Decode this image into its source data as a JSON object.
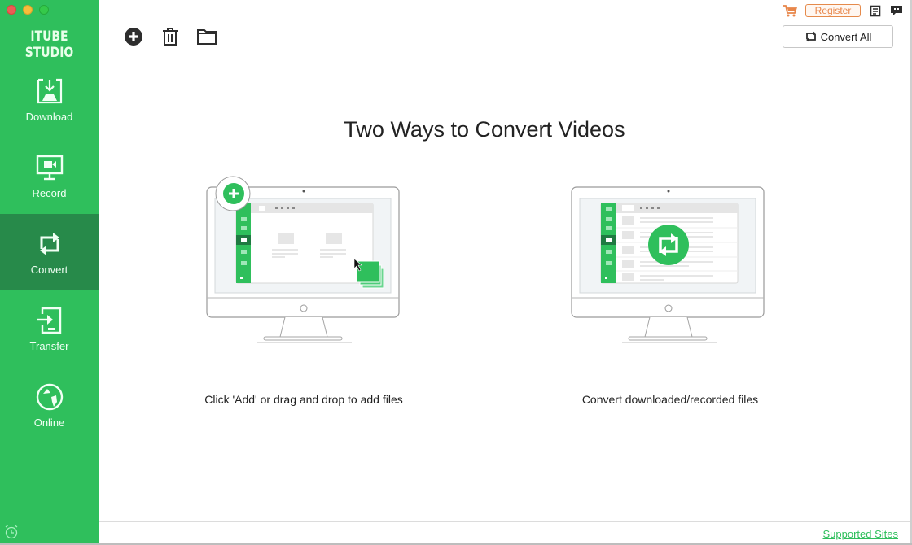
{
  "app": {
    "title": "ITUBE STUDIO"
  },
  "window_controls": {
    "close": "close",
    "minimize": "minimize",
    "maximize": "maximize"
  },
  "sidebar": {
    "items": [
      {
        "id": "download",
        "label": "Download",
        "icon": "download-icon",
        "active": false
      },
      {
        "id": "record",
        "label": "Record",
        "icon": "record-monitor-icon",
        "active": false
      },
      {
        "id": "convert",
        "label": "Convert",
        "icon": "convert-icon",
        "active": true
      },
      {
        "id": "transfer",
        "label": "Transfer",
        "icon": "transfer-icon",
        "active": false
      },
      {
        "id": "online",
        "label": "Online",
        "icon": "globe-icon",
        "active": false
      }
    ],
    "bottom_icon": "alarm-clock-icon"
  },
  "toolbar": {
    "add_icon": "add-circle-icon",
    "delete_icon": "trash-icon",
    "folder_icon": "folder-icon",
    "cart_icon": "cart-icon",
    "register_label": "Register",
    "notes_icon": "clipboard-icon",
    "chat_icon": "chat-icon",
    "convert_all_label": "Convert All"
  },
  "main": {
    "heading": "Two Ways to Convert Videos",
    "options": [
      {
        "caption": "Click 'Add' or drag and drop to add files",
        "illustration": "add-files-illustration"
      },
      {
        "caption": "Convert downloaded/recorded files",
        "illustration": "convert-files-illustration"
      }
    ]
  },
  "footer": {
    "supported_sites_label": "Supported Sites"
  },
  "colors": {
    "brand_green": "#2fbf5c",
    "active_green": "#278a4a",
    "register_orange": "#e8864a"
  }
}
